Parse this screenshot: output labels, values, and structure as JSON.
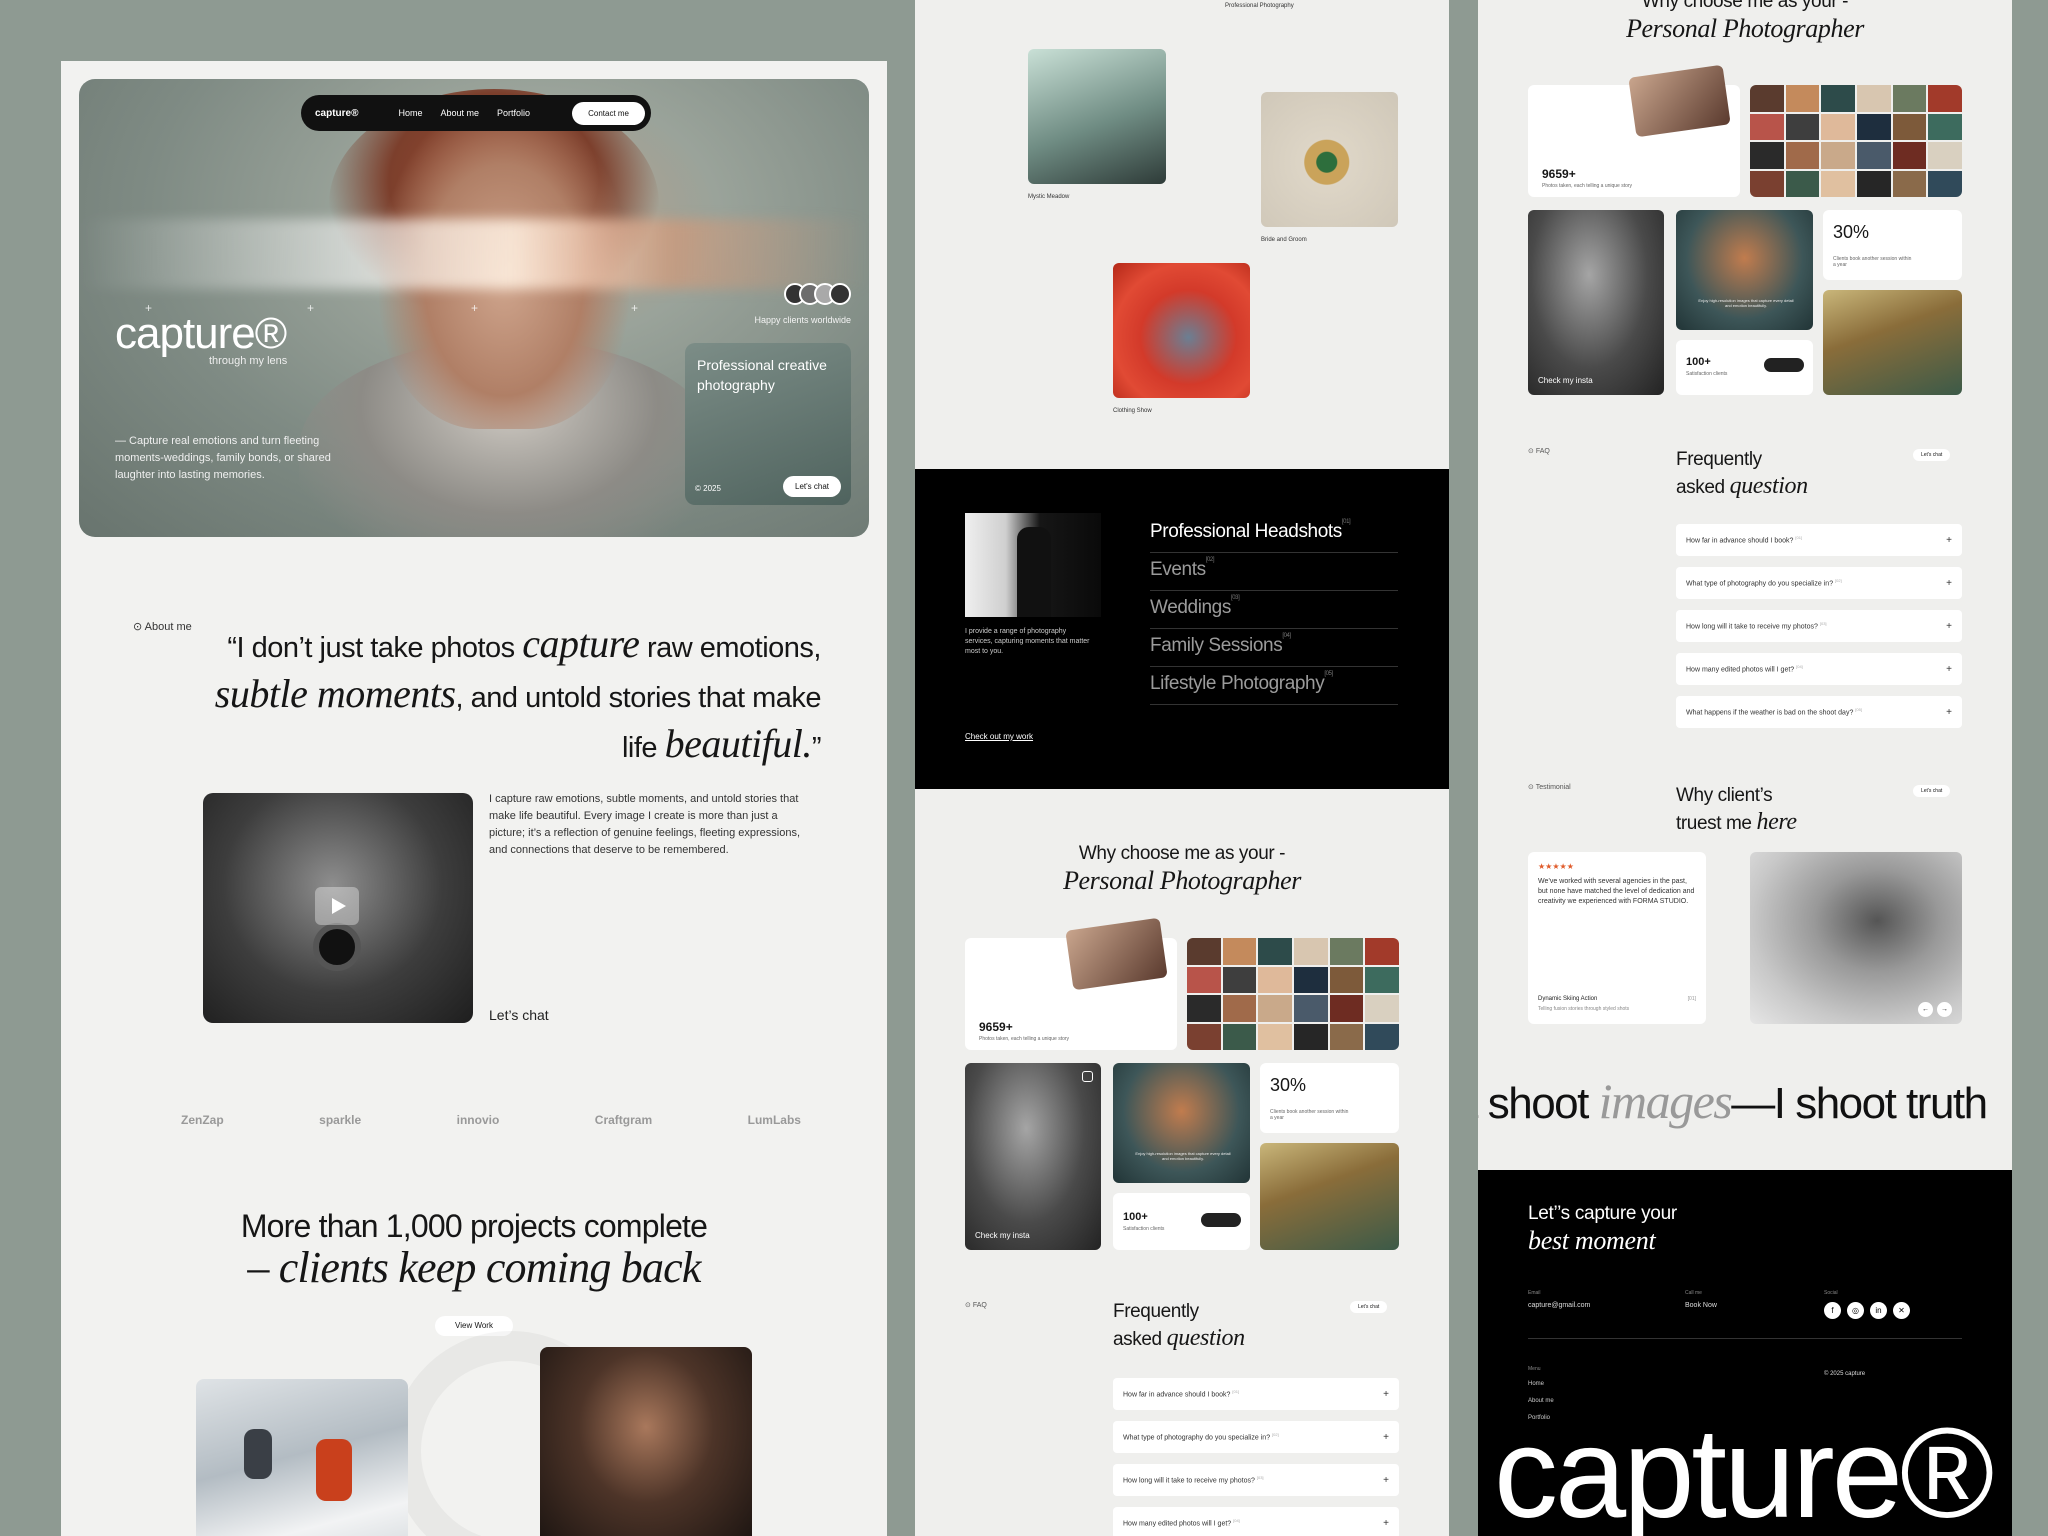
{
  "hero": {
    "nav": {
      "logo": "capture®",
      "items": [
        "Home",
        "About me",
        "Portfolio"
      ],
      "cta": "Contact me"
    },
    "title": "capture®",
    "subtitle": "through my lens",
    "description": "— Capture real emotions and turn fleeting moments-weddings, family bonds, or shared laughter into lasting memories.",
    "happy_clients": "Happy clients worldwide",
    "card": {
      "title": "Professional creative photography",
      "year": "© 2025",
      "button": "Let's chat"
    }
  },
  "about": {
    "tag": "About me",
    "quote": {
      "p1": "“I don’t just take photos ",
      "i1": "capture",
      "p2": " raw emotions, ",
      "i2": "subtle moments",
      "p3": ", and untold stories that make life ",
      "i3": "beautiful.",
      "p4": "”"
    },
    "text": "I capture raw emotions, subtle moments, and untold stories that make life beautiful. Every image I create is more than just a picture; it’s a reflection of genuine feelings, fleeting expressions, and connections that deserve to be remembered.",
    "cta": "Let’s chat"
  },
  "logos": [
    "ZenZap",
    "sparkle",
    "innovio",
    "Craftgram",
    "LumLabs"
  ],
  "projects": {
    "line1": "More than 1,000 projects complete",
    "line2": "– clients keep coming back",
    "button": "View Work"
  },
  "gallery": {
    "top_label": "Professional Photography",
    "items": [
      "Mystic Meadow",
      "Bride and Groom",
      "Clothing Show"
    ]
  },
  "services": {
    "description": "I provide a range of photography services, capturing moments that matter most to you.",
    "link": "Check out my work",
    "items": [
      {
        "name": "Professional Headshots",
        "idx": "[01]"
      },
      {
        "name": "Events",
        "idx": "[02]"
      },
      {
        "name": "Weddings",
        "idx": "[03]"
      },
      {
        "name": "Family Sessions",
        "idx": "[04]"
      },
      {
        "name": "Lifestyle Photography",
        "idx": "[05]"
      }
    ]
  },
  "why": {
    "line1": "Why choose me as your -",
    "line2": "Personal Photographer",
    "photos": "9659+",
    "photos_note": "Photos taken, each telling a unique story",
    "insta": "Check my insta",
    "percent": "30%",
    "percent_note": "Clients book another session within a year",
    "clients": "100+",
    "clients_note": "Satisfaction clients",
    "portrait_note": "Enjoy high-resolution images that capture every detail and emotion beautifully."
  },
  "faq": {
    "tag": "FAQ",
    "line1": "Frequently",
    "line2a": "asked ",
    "line2b": "question",
    "pill": "Let's chat",
    "items": [
      {
        "q": "How far in advance should I book?",
        "i": "[01]"
      },
      {
        "q": "What type of photography do you specialize in?",
        "i": "[02]"
      },
      {
        "q": "How long will it take to receive my photos?",
        "i": "[03]"
      },
      {
        "q": "How many edited photos will I get?",
        "i": "[04]"
      },
      {
        "q": "What happens if the weather is bad on the shoot day?",
        "i": "[05]"
      }
    ]
  },
  "p3": {
    "why_line1": "Why choose me as your -",
    "why_line2": "Personal Photographer"
  },
  "testimonial": {
    "tag": "Testimonial",
    "line1": "Why client’s",
    "line2a": "truest me ",
    "line2b": "here",
    "pill": "Let's chat",
    "stars": "★★★★★",
    "text": "We’ve worked with several agencies in the past, but none have matched the level of dedication and creativity we experienced with FORMA STUDIO.",
    "name": "Dynamic Skiing Action",
    "role": "Telling fusion stories through styled shots",
    "idx": "[01]"
  },
  "ticker": {
    "a": "’t shoot ",
    "b": "images",
    "c": "—I shoot truth"
  },
  "footer": {
    "line1": "Let’’s capture your",
    "line2": "best moment",
    "email_label": "Email",
    "email": "capture@gmail.com",
    "call_label": "Call me",
    "call": "Book Now",
    "social_label": "Social",
    "menu_label": "Menu",
    "menu": [
      "Home",
      "About me",
      "Portfolio"
    ],
    "copyright": "© 2025 capture",
    "big_logo": "capture®"
  },
  "colors": {
    "accent": "#e05b2b",
    "dark": "#000000",
    "panel": "#efefed",
    "frame": "#8e9a92"
  }
}
